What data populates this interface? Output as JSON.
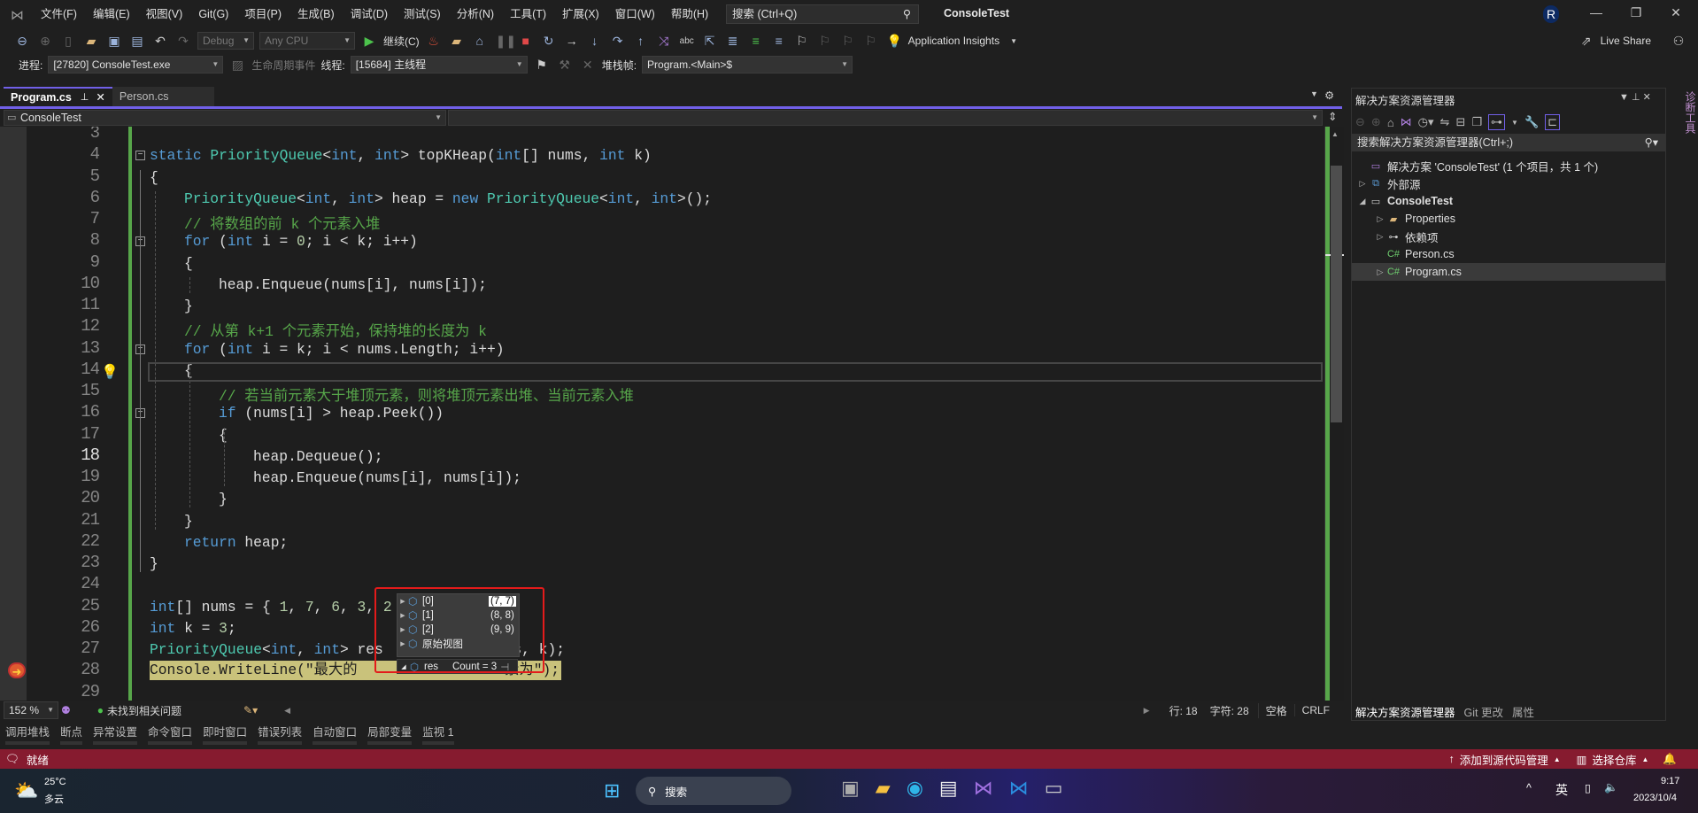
{
  "menubar": {
    "items": [
      "文件(F)",
      "编辑(E)",
      "视图(V)",
      "Git(G)",
      "项目(P)",
      "生成(B)",
      "调试(D)",
      "测试(S)",
      "分析(N)",
      "工具(T)",
      "扩展(X)",
      "窗口(W)",
      "帮助(H)"
    ],
    "search_placeholder": "搜索 (Ctrl+Q)",
    "title": "ConsoleTest",
    "avatar_initial": "R"
  },
  "toolbar": {
    "config": "Debug",
    "platform": "Any CPU",
    "continue_label": "继续(C)",
    "app_insights": "Application Insights",
    "live_share": "Live Share"
  },
  "debugbar": {
    "process_label": "进程:",
    "process_value": "[27820] ConsoleTest.exe",
    "lifecycle_label": "生命周期事件",
    "thread_label": "线程:",
    "thread_value": "[15684] 主线程",
    "stackframe_label": "堆栈帧:",
    "stackframe_value": "Program.<Main>$"
  },
  "tabs": [
    {
      "label": "Program.cs",
      "active": true
    },
    {
      "label": "Person.cs",
      "active": false
    }
  ],
  "navbar": {
    "project": "ConsoleTest"
  },
  "code": {
    "current_line": 18,
    "lines": [
      {
        "n": 3,
        "i": 0,
        "s": []
      },
      {
        "n": 4,
        "i": 0,
        "s": [
          [
            "kw",
            "static "
          ],
          [
            "ty",
            "PriorityQueue"
          ],
          [
            "tx",
            "<"
          ],
          [
            "kw",
            "int"
          ],
          [
            "tx",
            ", "
          ],
          [
            "kw",
            "int"
          ],
          [
            "tx",
            "> topKHeap("
          ],
          [
            "kw",
            "int"
          ],
          [
            "tx",
            "[] nums, "
          ],
          [
            "kw",
            "int"
          ],
          [
            "tx",
            " k)"
          ]
        ]
      },
      {
        "n": 5,
        "i": 0,
        "s": [
          [
            "tx",
            "{"
          ]
        ]
      },
      {
        "n": 6,
        "i": 1,
        "s": [
          [
            "ty",
            "PriorityQueue"
          ],
          [
            "tx",
            "<"
          ],
          [
            "kw",
            "int"
          ],
          [
            "tx",
            ", "
          ],
          [
            "kw",
            "int"
          ],
          [
            "tx",
            "> heap = "
          ],
          [
            "kw",
            "new "
          ],
          [
            "ty",
            "PriorityQueue"
          ],
          [
            "tx",
            "<"
          ],
          [
            "kw",
            "int"
          ],
          [
            "tx",
            ", "
          ],
          [
            "kw",
            "int"
          ],
          [
            "tx",
            ">();"
          ]
        ]
      },
      {
        "n": 7,
        "i": 1,
        "s": [
          [
            "cm",
            "// 将数组的前 k 个元素入堆"
          ]
        ]
      },
      {
        "n": 8,
        "i": 1,
        "s": [
          [
            "kw",
            "for"
          ],
          [
            "tx",
            " ("
          ],
          [
            "kw",
            "int"
          ],
          [
            "tx",
            " i = "
          ],
          [
            "nu",
            "0"
          ],
          [
            "tx",
            "; i < k; i++)"
          ]
        ]
      },
      {
        "n": 9,
        "i": 1,
        "s": [
          [
            "tx",
            "{"
          ]
        ]
      },
      {
        "n": 10,
        "i": 2,
        "s": [
          [
            "tx",
            "heap.Enqueue(nums[i], nums[i]);"
          ]
        ]
      },
      {
        "n": 11,
        "i": 1,
        "s": [
          [
            "tx",
            "}"
          ]
        ]
      },
      {
        "n": 12,
        "i": 1,
        "s": [
          [
            "cm",
            "// 从第 k+1 个元素开始，保持堆的长度为 k"
          ]
        ]
      },
      {
        "n": 13,
        "i": 1,
        "s": [
          [
            "kw",
            "for"
          ],
          [
            "tx",
            " ("
          ],
          [
            "kw",
            "int"
          ],
          [
            "tx",
            " i = k; i < nums.Length; i++)"
          ]
        ]
      },
      {
        "n": 14,
        "i": 1,
        "s": [
          [
            "tx",
            "{"
          ]
        ]
      },
      {
        "n": 15,
        "i": 2,
        "s": [
          [
            "cm",
            "// 若当前元素大于堆顶元素，则将堆顶元素出堆、当前元素入堆"
          ]
        ]
      },
      {
        "n": 16,
        "i": 2,
        "s": [
          [
            "kw",
            "if"
          ],
          [
            "tx",
            " (nums[i] > heap.Peek())"
          ]
        ]
      },
      {
        "n": 17,
        "i": 2,
        "s": [
          [
            "tx",
            "{"
          ]
        ]
      },
      {
        "n": 18,
        "i": 3,
        "s": [
          [
            "tx",
            "heap.Dequeue();"
          ]
        ]
      },
      {
        "n": 19,
        "i": 3,
        "s": [
          [
            "tx",
            "heap.Enqueue(nums[i], nums[i]);"
          ]
        ]
      },
      {
        "n": 20,
        "i": 2,
        "s": [
          [
            "tx",
            "}"
          ]
        ]
      },
      {
        "n": 21,
        "i": 1,
        "s": [
          [
            "tx",
            "}"
          ]
        ]
      },
      {
        "n": 22,
        "i": 1,
        "s": [
          [
            "kw",
            "return"
          ],
          [
            "tx",
            " heap;"
          ]
        ]
      },
      {
        "n": 23,
        "i": 0,
        "s": [
          [
            "tx",
            "}"
          ]
        ]
      },
      {
        "n": 24,
        "i": 0,
        "s": []
      },
      {
        "n": 25,
        "i": 0,
        "s": [
          [
            "kw",
            "int"
          ],
          [
            "tx",
            "[] nums = { "
          ],
          [
            "nu",
            "1"
          ],
          [
            "tx",
            ", "
          ],
          [
            "nu",
            "7"
          ],
          [
            "tx",
            ", "
          ],
          [
            "nu",
            "6"
          ],
          [
            "tx",
            ", "
          ],
          [
            "nu",
            "3"
          ],
          [
            "tx",
            ", "
          ],
          [
            "nu",
            "2"
          ]
        ]
      },
      {
        "n": 26,
        "i": 0,
        "s": [
          [
            "kw",
            "int"
          ],
          [
            "tx",
            " k = "
          ],
          [
            "nu",
            "3"
          ],
          [
            "tx",
            ";"
          ]
        ]
      },
      {
        "n": 27,
        "i": 0,
        "s": [
          [
            "ty",
            "PriorityQueue"
          ],
          [
            "tx",
            "<"
          ],
          [
            "kw",
            "int"
          ],
          [
            "tx",
            ", "
          ],
          [
            "kw",
            "int"
          ],
          [
            "tx",
            "> res               s, k);"
          ]
        ]
      },
      {
        "n": 28,
        "i": 0,
        "s": []
      },
      {
        "n": 29,
        "i": 0,
        "s": []
      }
    ],
    "line28_left": "Console.WriteLine(\"最大的",
    "line28_right": "素为\");"
  },
  "datatip": {
    "items": [
      {
        "name": "[0]",
        "value": "(7, 7)"
      },
      {
        "name": "[1]",
        "value": "(8, 8)"
      },
      {
        "name": "[2]",
        "value": "(9, 9)"
      },
      {
        "name": "原始视图",
        "value": ""
      }
    ],
    "root_name": "res",
    "root_value": "Count = 3"
  },
  "editor_status": {
    "zoom": "152 %",
    "issues": "未找到相关问题",
    "line": "行: 18",
    "char": "字符: 28",
    "spaces": "空格",
    "eol": "CRLF"
  },
  "bottom_tabs": [
    "调用堆栈",
    "断点",
    "异常设置",
    "命令窗口",
    "即时窗口",
    "错误列表",
    "自动窗口",
    "局部变量",
    "监视 1"
  ],
  "solution_explorer": {
    "title": "解决方案资源管理器",
    "search_placeholder": "搜索解决方案资源管理器(Ctrl+;)",
    "tree": [
      {
        "label": "解决方案 'ConsoleTest' (1 个项目，共 1 个)",
        "level": 0,
        "expander": "",
        "icon": "solution-icon"
      },
      {
        "label": "外部源",
        "level": 0,
        "expander": "▷",
        "icon": "external-sources-icon"
      },
      {
        "label": "ConsoleTest",
        "level": 0,
        "expander": "◢",
        "icon": "project-icon",
        "bold": true
      },
      {
        "label": "Properties",
        "level": 1,
        "expander": "▷",
        "icon": "properties-folder-icon"
      },
      {
        "label": "依赖项",
        "level": 1,
        "expander": "▷",
        "icon": "dependencies-icon"
      },
      {
        "label": "Person.cs",
        "level": 1,
        "expander": "",
        "icon": "csharp-file-icon"
      },
      {
        "label": "Program.cs",
        "level": 1,
        "expander": "▷",
        "icon": "csharp-file-icon",
        "selected": true
      }
    ],
    "bottom_tabs": [
      "解决方案资源管理器",
      "Git 更改",
      "属性"
    ],
    "side_strip": "诊断工具"
  },
  "statusbar": {
    "ready": "就绪",
    "add_source_control": "添加到源代码管理",
    "select_repo": "选择仓库",
    "color": "#861b2f"
  },
  "taskbar": {
    "weather_temp": "25°C",
    "weather_desc": "多云",
    "search": "搜索",
    "ime": "英",
    "time": "9:17",
    "date": "2023/10/4"
  },
  "colors": {
    "accent": "#7160e8",
    "keyword": "#569cd6",
    "type": "#4ec9b0",
    "comment": "#57a64a",
    "highlight": "#c9c27b",
    "changed_bar": "#57a64a"
  }
}
